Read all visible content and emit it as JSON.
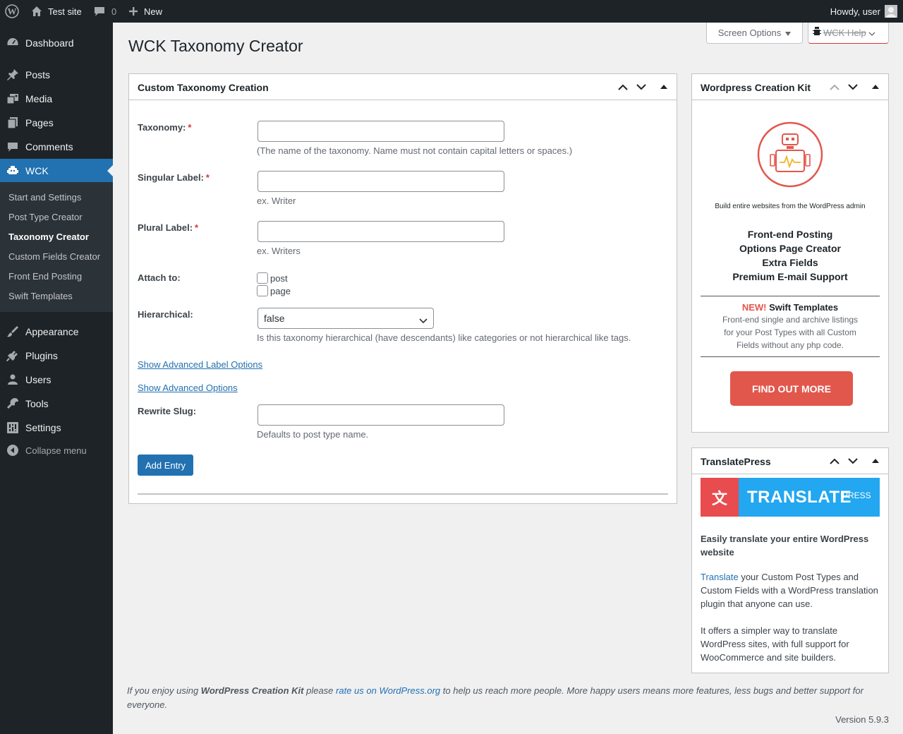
{
  "adminbar": {
    "wp_logo": "wordpress-logo-icon",
    "site_name": "Test site",
    "comments_count": "0",
    "new_label": "New",
    "howdy": "Howdy, user"
  },
  "sidebar": {
    "items": [
      {
        "label": "Dashboard",
        "icon": "dashboard-icon"
      },
      {
        "label": "Posts",
        "icon": "pin-icon"
      },
      {
        "label": "Media",
        "icon": "media-icon"
      },
      {
        "label": "Pages",
        "icon": "pages-icon"
      },
      {
        "label": "Comments",
        "icon": "comment-icon"
      },
      {
        "label": "WCK",
        "icon": "wck-icon"
      },
      {
        "label": "Appearance",
        "icon": "brush-icon"
      },
      {
        "label": "Plugins",
        "icon": "plugin-icon"
      },
      {
        "label": "Users",
        "icon": "users-icon"
      },
      {
        "label": "Tools",
        "icon": "wrench-icon"
      },
      {
        "label": "Settings",
        "icon": "settings-icon"
      }
    ],
    "submenu": [
      {
        "label": "Start and Settings"
      },
      {
        "label": "Post Type Creator"
      },
      {
        "label": "Taxonomy Creator"
      },
      {
        "label": "Custom Fields Creator"
      },
      {
        "label": "Front End Posting"
      },
      {
        "label": "Swift Templates"
      }
    ],
    "collapse_label": "Collapse menu"
  },
  "header": {
    "screen_options": "Screen Options",
    "wck_help": "WCK Help",
    "title": "WCK Taxonomy Creator"
  },
  "form_box": {
    "title": "Custom Taxonomy Creation",
    "taxonomy_label": "Taxonomy:",
    "taxonomy_desc": "(The name of the taxonomy. Name must not contain capital letters or spaces.)",
    "singular_label": "Singular Label:",
    "singular_desc": "ex. Writer",
    "plural_label": "Plural Label:",
    "plural_desc": "ex. Writers",
    "attach_label": "Attach to:",
    "attach_options": [
      "post",
      "page"
    ],
    "hierarchical_label": "Hierarchical:",
    "hierarchical_value": "false",
    "hierarchical_desc": "Is this taxonomy hierarchical (have descendants) like categories or not hierarchical like tags.",
    "adv_label_link": "Show Advanced Label Options",
    "adv_options_link": "Show Advanced Options",
    "rewrite_label": "Rewrite Slug:",
    "rewrite_desc": "Defaults to post type name.",
    "add_button": "Add Entry"
  },
  "wck_box": {
    "title": "Wordpress Creation Kit",
    "tagline": "Build entire websites from the WordPress admin",
    "features": [
      "Front-end Posting",
      "Options Page Creator",
      "Extra Fields",
      "Premium E-mail Support"
    ],
    "new_badge": "NEW!",
    "swift_title": "Swift Templates",
    "swift_desc": [
      "Front-end single and archive listings",
      "for your Post Types with all Custom",
      "Fields without any php code."
    ],
    "button": "FIND OUT MORE"
  },
  "tp_box": {
    "title": "TranslatePress",
    "banner_icon": "文",
    "banner_word": "TRANSLATE",
    "banner_press": "PRESS",
    "headline": "Easily translate your entire WordPress website",
    "link": "Translate",
    "para1_rest": " your Custom Post Types and Custom Fields with a WordPress translation plugin that anyone can use.",
    "para2": "It offers a simpler way to translate WordPress sites, with full support for WooCommerce and site builders."
  },
  "footer": {
    "prefix": "If you enjoy using ",
    "product": "WordPress Creation Kit",
    "mid": " please ",
    "link": "rate us on WordPress.org",
    "suffix": " to help us reach more people. More happy users means more features, less bugs and better support for everyone.",
    "version": "Version 5.9.3"
  },
  "colors": {
    "admin_dark": "#1d2327",
    "accent_blue": "#2271b1",
    "required_red": "#d63638",
    "wck_red": "#e2574c",
    "tp_blue": "#22a7f0"
  }
}
